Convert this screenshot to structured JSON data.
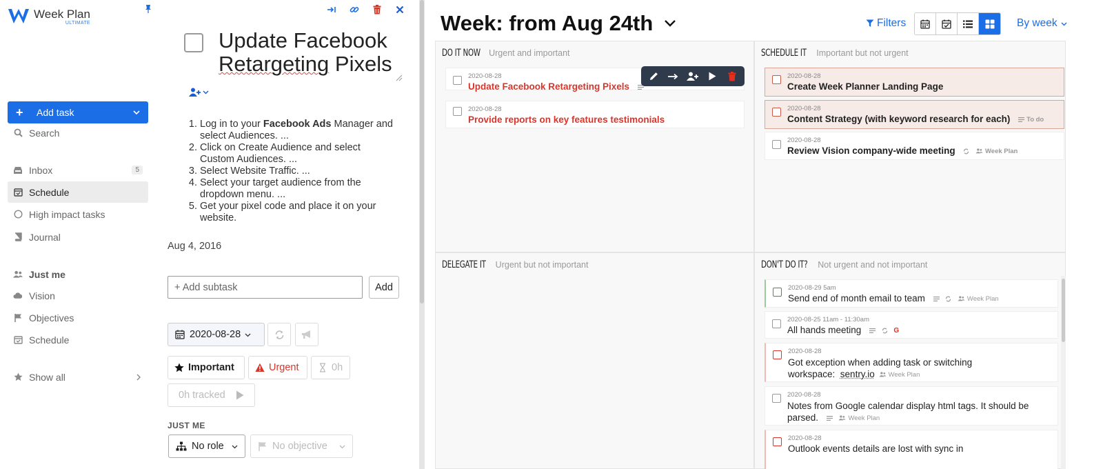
{
  "app": {
    "name": "Week Plan",
    "edition": "ULTIMATE",
    "accent": "#1b6ee5"
  },
  "sidebar": {
    "add_task": "Add task",
    "search": "Search",
    "items": [
      {
        "label": "Inbox",
        "icon": "inbox-icon",
        "badge": "5"
      },
      {
        "label": "Schedule",
        "icon": "calendar-check-icon",
        "active": true
      },
      {
        "label": "High impact tasks",
        "icon": "circle-icon"
      },
      {
        "label": "Journal",
        "icon": "book-icon"
      }
    ],
    "workspace": "Just me",
    "workspace_items": [
      {
        "label": "Vision",
        "icon": "cloud-icon"
      },
      {
        "label": "Objectives",
        "icon": "flag-icon"
      },
      {
        "label": "Schedule",
        "icon": "calendar-check-icon"
      }
    ],
    "show_all": "Show all"
  },
  "detail": {
    "title_line1": "Update Facebook",
    "title_word_a": "Retargeting",
    "title_word_b": "Pixels",
    "steps": [
      {
        "pre": "Log in to your ",
        "bold": "Facebook Ads",
        "post": " Manager and select Audiences. ..."
      },
      {
        "pre": "Click on Create Audience and select Custom Audiences. ...",
        "bold": "",
        "post": ""
      },
      {
        "pre": "Select Website Traffic. ...",
        "bold": "",
        "post": ""
      },
      {
        "pre": "Select your target audience from the dropdown menu. ...",
        "bold": "",
        "post": ""
      },
      {
        "pre": "Get your pixel code and place it on your website.",
        "bold": "",
        "post": ""
      }
    ],
    "created": "Aug 4, 2016",
    "subtask_placeholder": "+ Add subtask",
    "subtask_add": "Add",
    "date": "2020-08-28",
    "important": "Important",
    "urgent": "Urgent",
    "estimate": "0h",
    "tracked": "0h tracked",
    "section": "JUST ME",
    "role": "No role",
    "objective": "No objective"
  },
  "main": {
    "week_title": "Week: from Aug 24th",
    "filters": "Filters",
    "by_week": "By week",
    "quadrants": {
      "do": {
        "title": "DO IT NOW",
        "subtitle": "Urgent and important",
        "tasks": [
          {
            "date": "2020-08-28",
            "name": "Update Facebook Retargeting Pixels"
          },
          {
            "date": "2020-08-28",
            "name": "Provide reports on key features testimonials"
          }
        ]
      },
      "schedule": {
        "title": "SCHEDULE IT",
        "subtitle": "Important but not urgent",
        "tasks": [
          {
            "date": "2020-08-28",
            "name": "Create Week Planner Landing Page"
          },
          {
            "date": "2020-08-28",
            "name": "Content Strategy (with keyword research for each)",
            "tag": "To do"
          },
          {
            "date": "2020-08-28",
            "name": "Review Vision company-wide meeting",
            "tag": "Week Plan"
          }
        ]
      },
      "delegate": {
        "title": "DELEGATE IT",
        "subtitle": "Urgent but not important"
      },
      "dont": {
        "title": "DON'T DO IT?",
        "subtitle": "Not urgent and not important",
        "tasks": [
          {
            "date": "2020-08-29 5am",
            "name": "Send end of month email to team",
            "tag": "Week Plan"
          },
          {
            "date": "2020-08-25 11am - 11:30am",
            "name": "All hands meeting",
            "g": "G"
          },
          {
            "date": "2020-08-28",
            "name_line1": "Got exception when adding task or switching",
            "name_line2": "workspace:",
            "link": "sentry.io",
            "tag": "Week Plan"
          },
          {
            "date": "2020-08-28",
            "name_line1": "Notes from Google calendar display html tags. It should be",
            "name_line2": "parsed.",
            "tag": "Week Plan"
          },
          {
            "date": "2020-08-28",
            "name_line1": "Outlook events details are lost with sync in"
          }
        ]
      }
    }
  }
}
